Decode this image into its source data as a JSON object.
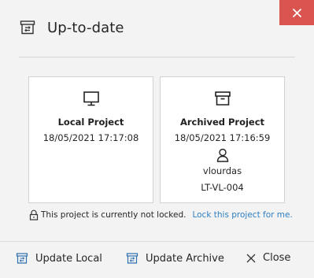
{
  "dialog": {
    "title": "Up-to-date",
    "close_icon": "close-x-icon",
    "accent_color": "#d9534f"
  },
  "local": {
    "icon": "monitor-icon",
    "title": "Local Project",
    "timestamp": "18/05/2021 17:17:08"
  },
  "archive": {
    "icon": "archive-box-icon",
    "title": "Archived Project",
    "timestamp": "18/05/2021 17:16:59",
    "user_icon": "user-icon",
    "user": "vlourdas",
    "machine": "LT-VL-004"
  },
  "lock": {
    "icon": "padlock-icon",
    "status": "This project is currently not locked.",
    "link": "Lock this project for me.",
    "link_color": "#2e7fc4"
  },
  "footer": {
    "update_local": "Update Local",
    "update_archive": "Update Archive",
    "close": "Close"
  }
}
